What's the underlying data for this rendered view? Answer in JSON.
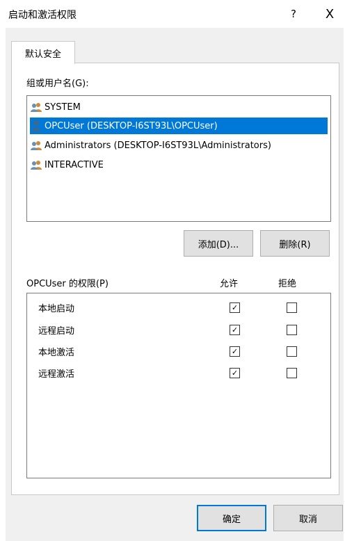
{
  "window": {
    "title": "启动和激活权限",
    "help": "?",
    "close": "X"
  },
  "tabs": [
    {
      "label": "默认安全"
    }
  ],
  "group_label": "组或用户名(G):",
  "users": [
    {
      "name": "SYSTEM",
      "icon": "users-group-icon"
    },
    {
      "name": "OPCUser (DESKTOP-I6ST93L\\OPCUser)",
      "icon": "user-icon",
      "selected": true
    },
    {
      "name": "Administrators (DESKTOP-I6ST93L\\Administrators)",
      "icon": "users-group-icon"
    },
    {
      "name": "INTERACTIVE",
      "icon": "users-group-icon"
    }
  ],
  "buttons": {
    "add": "添加(D)...",
    "remove": "删除(R)",
    "ok": "确定",
    "cancel": "取消"
  },
  "permissions": {
    "label": "OPCUser 的权限(P)",
    "allow_header": "允许",
    "deny_header": "拒绝",
    "rows": [
      {
        "name": "本地启动",
        "allow": true,
        "deny": false
      },
      {
        "name": "远程启动",
        "allow": true,
        "deny": false
      },
      {
        "name": "本地激活",
        "allow": true,
        "deny": false
      },
      {
        "name": "远程激活",
        "allow": true,
        "deny": false
      }
    ]
  },
  "colors": {
    "selection": "#0078d7",
    "dialog_bg": "#f0f0f0"
  }
}
